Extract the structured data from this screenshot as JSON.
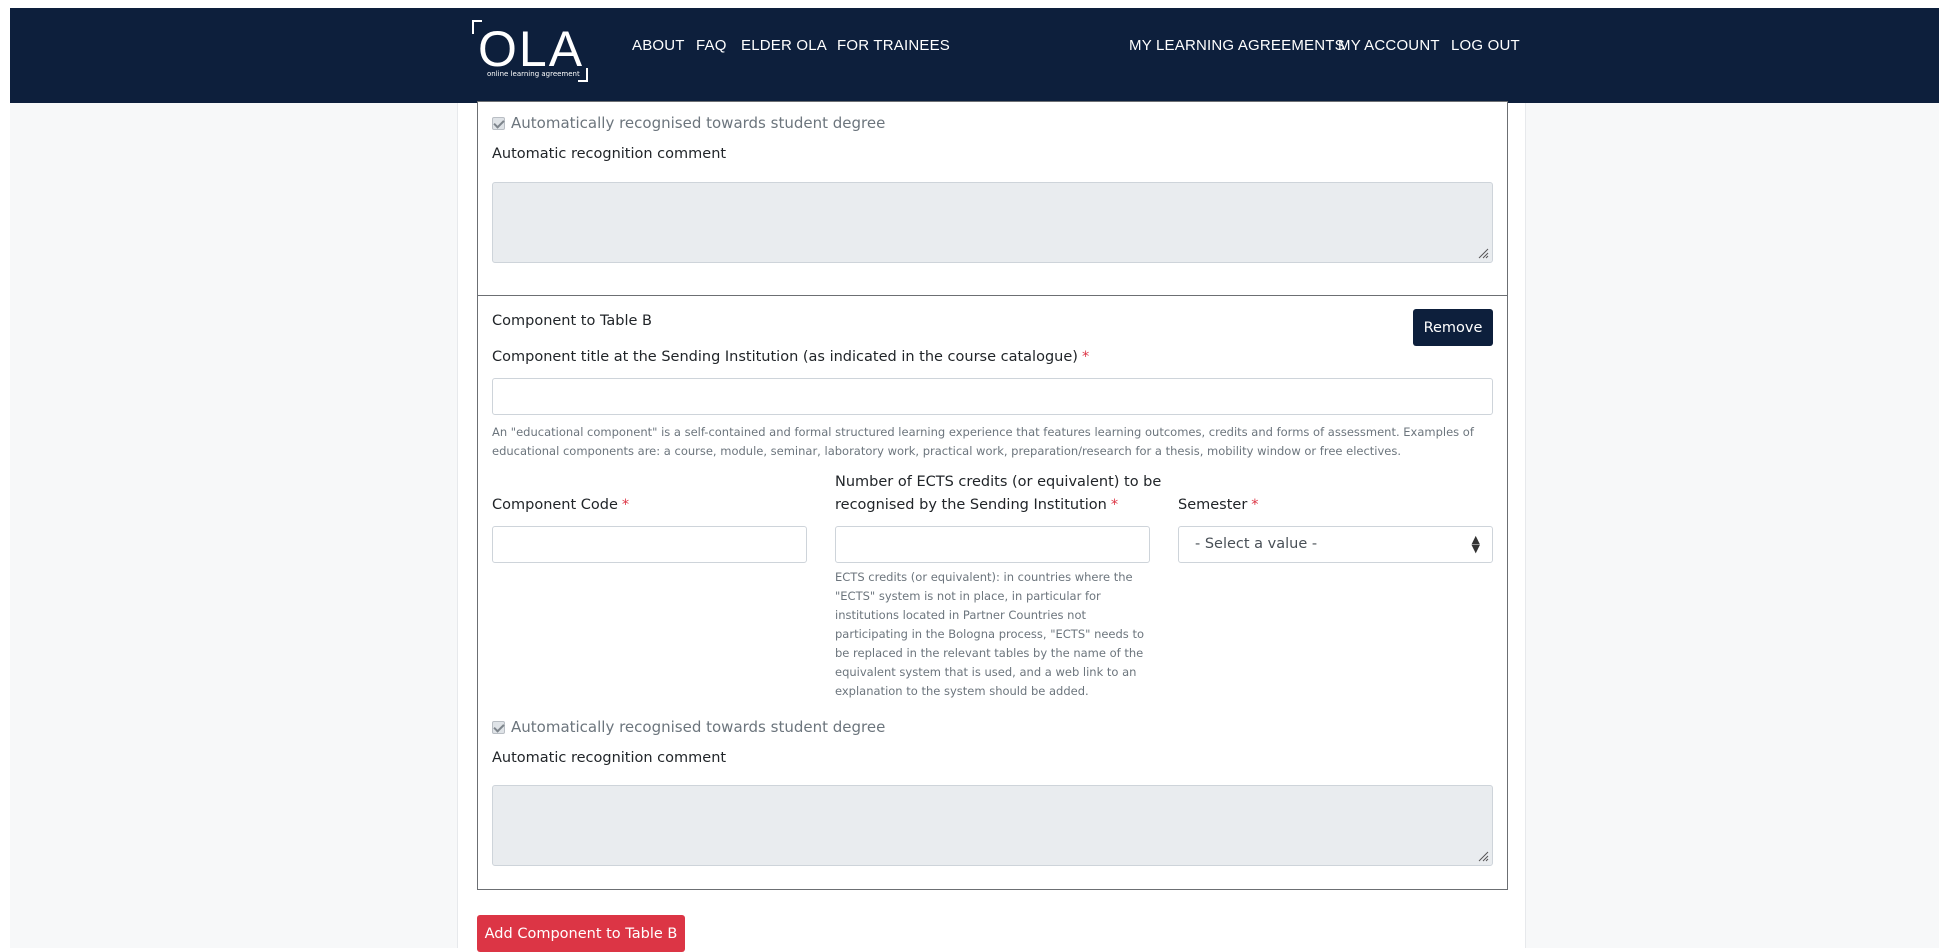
{
  "app": {
    "logo_text": "OLA",
    "logo_subtitle": "online learning agreement"
  },
  "nav": {
    "left": [
      "ABOUT",
      "FAQ",
      "ELDER OLA",
      "FOR TRAINEES"
    ],
    "right": [
      "MY LEARNING AGREEMENTS",
      "MY ACCOUNT",
      "LOG OUT"
    ]
  },
  "card1": {
    "auto_recognised_label": "Automatically recognised towards student degree",
    "auto_recognised_checked": true,
    "comment_label": "Automatic recognition comment",
    "comment_value": ""
  },
  "card2": {
    "heading": "Component to Table B",
    "remove_button": "Remove",
    "title_label": "Component title at the Sending Institution (as indicated in the course catalogue)",
    "required_mark": "*",
    "title_value": "",
    "title_help_line1": "An \"educational component\" is a self-contained and formal structured learning experience that features learning outcomes, credits and forms of assessment. Examples of",
    "title_help_line2": "educational components are: a course, module, seminar, laboratory work, practical work, preparation/research for a thesis, mobility window or free electives.",
    "code_label": "Component Code",
    "code_value": "",
    "ects_label_line1": "Number of ECTS credits (or equivalent) to be",
    "ects_label_line2": "recognised by the Sending Institution",
    "ects_value": "",
    "ects_help": [
      "ECTS credits (or equivalent): in countries where the",
      "\"ECTS\" system is not in place, in particular for",
      "institutions located in Partner Countries not",
      "participating in the Bologna process, \"ECTS\" needs to",
      "be replaced in the relevant tables by the name of the",
      "equivalent system that is used, and a web link to an",
      "explanation to the system should be added."
    ],
    "semester_label": "Semester",
    "semester_value": "- Select a value -",
    "auto_recognised_label": "Automatically recognised towards student degree",
    "auto_recognised_checked": true,
    "comment_label": "Automatic recognition comment",
    "comment_value": ""
  },
  "add_button": "Add Component to Table B",
  "colors": {
    "navbar": "#0d1f3c",
    "danger": "#dc3545",
    "readonly_bg": "#e9ecef"
  }
}
